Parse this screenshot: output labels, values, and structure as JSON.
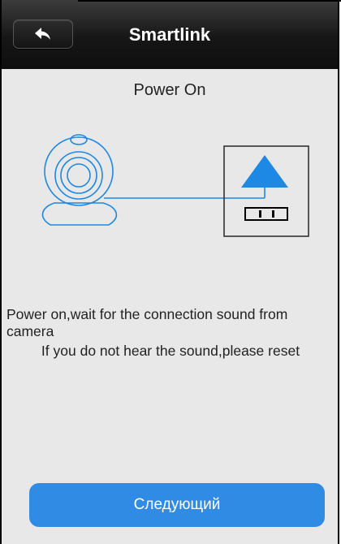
{
  "header": {
    "title": "Smartlink",
    "back_icon": "back-arrow-icon"
  },
  "main": {
    "step_title": "Power On",
    "instruction_line1": "Power on,wait for the connection sound from camera",
    "instruction_line2": "If you do not hear the sound,please reset",
    "illustration": {
      "camera_icon": "webcam-icon",
      "outlet_icon": "power-outlet-icon",
      "line_color": "#1e88e5"
    }
  },
  "footer": {
    "next_button_label": "Следующий"
  },
  "colors": {
    "accent": "#2f8be3",
    "header_bg": "#1a1a1a",
    "page_bg": "#e8e8e8"
  }
}
